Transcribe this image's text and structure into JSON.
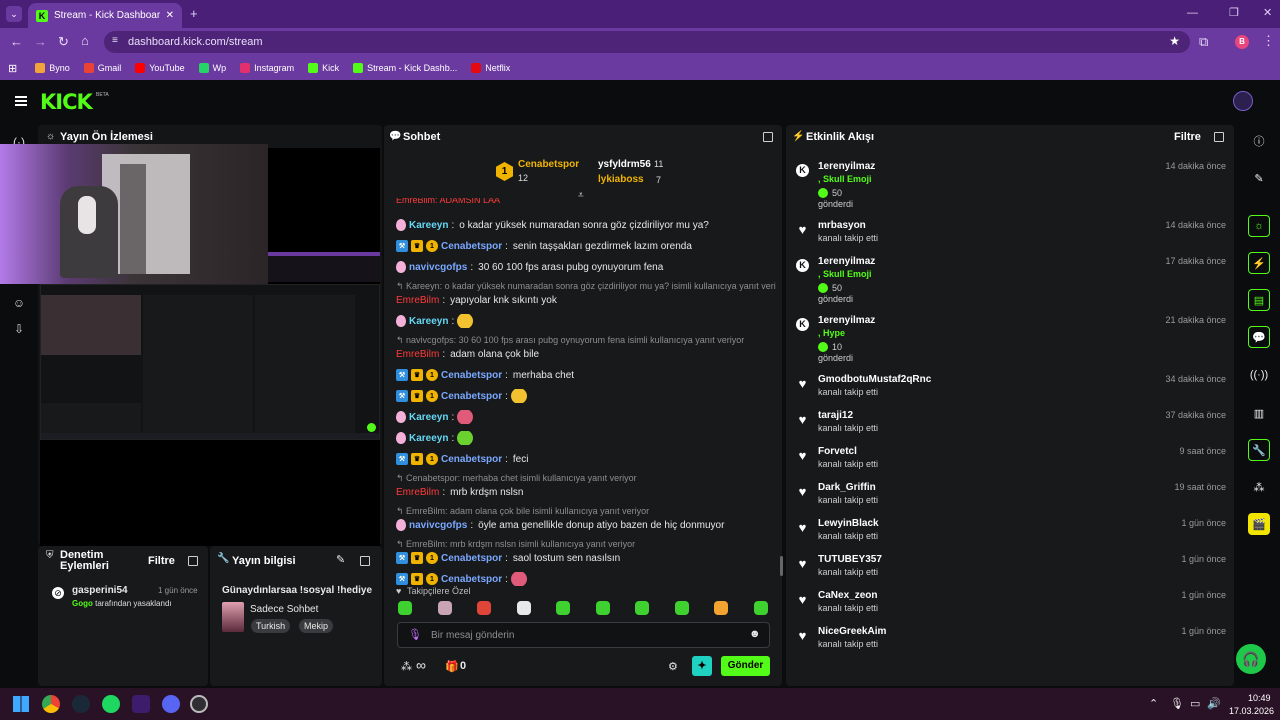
{
  "browser": {
    "tab_title": "Stream - Kick Dashboard",
    "url": "dashboard.kick.com/stream",
    "profile_initial": "B",
    "bookmarks": [
      {
        "label": "Byno",
        "color": "#f2a33a"
      },
      {
        "label": "Gmail",
        "color": "#ea4335"
      },
      {
        "label": "YouTube",
        "color": "#ff0000"
      },
      {
        "label": "Wp",
        "color": "#25d366"
      },
      {
        "label": "Instagram",
        "color": "#e1306c"
      },
      {
        "label": "Kick",
        "color": "#53fc18"
      },
      {
        "label": "Stream - Kick Dashb...",
        "color": "#53fc18"
      },
      {
        "label": "Netflix",
        "color": "#e50914"
      }
    ]
  },
  "kick": {
    "logo": "KICK",
    "beta": "BETA",
    "accent": "#53fc18"
  },
  "preview": {
    "title": "Yayın Ön İzlemesi"
  },
  "moderation": {
    "title": "Denetim Eylemleri",
    "filter": "Filtre",
    "items": [
      {
        "user": "gasperini54",
        "time": "1 gün önce",
        "actor": "Gogo",
        "action": "tarafından yasaklandı"
      }
    ]
  },
  "stream_info": {
    "title": "Yayın bilgisi",
    "stream_title": "Günaydınlarsaa !sosyal !hediye",
    "category": "Sadece Sohbet",
    "tags": [
      "Turkish",
      "Mekip"
    ]
  },
  "chat": {
    "title": "Sohbet",
    "leaderboard": [
      {
        "rank": "1",
        "name": "Cenabetspor",
        "count": "12"
      },
      {
        "name": "ysfyldrm56",
        "count": "11"
      },
      {
        "name": "lykiaboss",
        "count": "7"
      }
    ],
    "cut_line": "EmreBilm: ADAMSIN LAA",
    "messages": [
      {
        "user": "Kareeyn",
        "text": "o kadar yüksek numaradan sonra göz çizdiriliyor mu ya?"
      },
      {
        "user": "Cenabetspor",
        "text": "senin taşşakları gezdirmek lazım orenda"
      },
      {
        "user": "navivcgofps",
        "text": "30 60 100 fps arası pubg oynuyorum fena"
      },
      {
        "reply": "Kareeyn: o kadar yüksek numaradan sonra göz çizdiriliyor mu ya? isimli kullanıcıya yanıt veri...",
        "user": "EmreBilm",
        "text": "yapıyolar knk sıkıntı yok"
      },
      {
        "user": "Kareeyn",
        "text": ""
      },
      {
        "reply": "navivcgofps: 30 60 100 fps arası pubg oynuyorum fena isimli kullanıcıya yanıt veriyor",
        "user": "EmreBilm",
        "text": "adam olana çok bile"
      },
      {
        "user": "Cenabetspor",
        "text": "merhaba chet"
      },
      {
        "user": "Cenabetspor",
        "text": ""
      },
      {
        "user": "Kareeyn",
        "text": ""
      },
      {
        "user": "Kareeyn",
        "text": ""
      },
      {
        "user": "Cenabetspor",
        "text": "feci"
      },
      {
        "reply": "Cenabetspor: merhaba chet isimli kullanıcıya yanıt veriyor",
        "user": "EmreBilm",
        "text": "mrb krdşm nslsn"
      },
      {
        "reply": "EmreBilm: adam olana çok bile isimli kullanıcıya yanıt veriyor",
        "user": "navivcgofps",
        "text": "öyle ama genellikle donup atiyo bazen de hiç donmuyor"
      },
      {
        "reply": "EmreBilm: mrb krdşm nslsn isimli kullanıcıya yanıt veriyor",
        "user": "Cenabetspor",
        "text": "saol tostum sen nasılsın"
      },
      {
        "user": "Cenabetspor",
        "text": ""
      }
    ],
    "emote_section": "Takipçilere Özel",
    "input_placeholder": "Bir mesaj gönderin",
    "points_value": "∞",
    "gift_count": "0",
    "send_label": "Gönder"
  },
  "activity": {
    "title": "Etkinlik Akışı",
    "filter": "Filtre",
    "items": [
      {
        "user": "1erenyilmaz",
        "sub": ", Skull Emoji",
        "amount": "50",
        "sent": "gönderdi",
        "time": "14 dakika önce",
        "type": "kick"
      },
      {
        "user": "mrbasyon",
        "sub": "kanalı takip etti",
        "time": "14 dakika önce",
        "type": "follow"
      },
      {
        "user": "1erenyilmaz",
        "sub": ", Skull Emoji",
        "amount": "50",
        "sent": "gönderdi",
        "time": "17 dakika önce",
        "type": "kick"
      },
      {
        "user": "1erenyilmaz",
        "sub": ", Hype",
        "amount": "10",
        "sent": "gönderdi",
        "time": "21 dakika önce",
        "type": "kick"
      },
      {
        "user": "GmodbotuMustaf2qRnc",
        "sub": "kanalı takip etti",
        "time": "34 dakika önce",
        "type": "follow"
      },
      {
        "user": "taraji12",
        "sub": "kanalı takip etti",
        "time": "37 dakika önce",
        "type": "follow"
      },
      {
        "user": "Forvetcl",
        "sub": "kanalı takip etti",
        "time": "9 saat önce",
        "type": "follow"
      },
      {
        "user": "Dark_Griffin",
        "sub": "kanalı takip etti",
        "time": "19 saat önce",
        "type": "follow"
      },
      {
        "user": "LewyinBlack",
        "sub": "kanalı takip etti",
        "time": "1 gün önce",
        "type": "follow"
      },
      {
        "user": "TUTUBEY357",
        "sub": "kanalı takip etti",
        "time": "1 gün önce",
        "type": "follow"
      },
      {
        "user": "CaNex_zeon",
        "sub": "kanalı takip etti",
        "time": "1 gün önce",
        "type": "follow"
      },
      {
        "user": "NiceGreekAim",
        "sub": "kanalı takip etti",
        "time": "1 gün önce",
        "type": "follow"
      }
    ]
  },
  "taskbar": {
    "time": "10:49",
    "date": "17.03.2026"
  }
}
